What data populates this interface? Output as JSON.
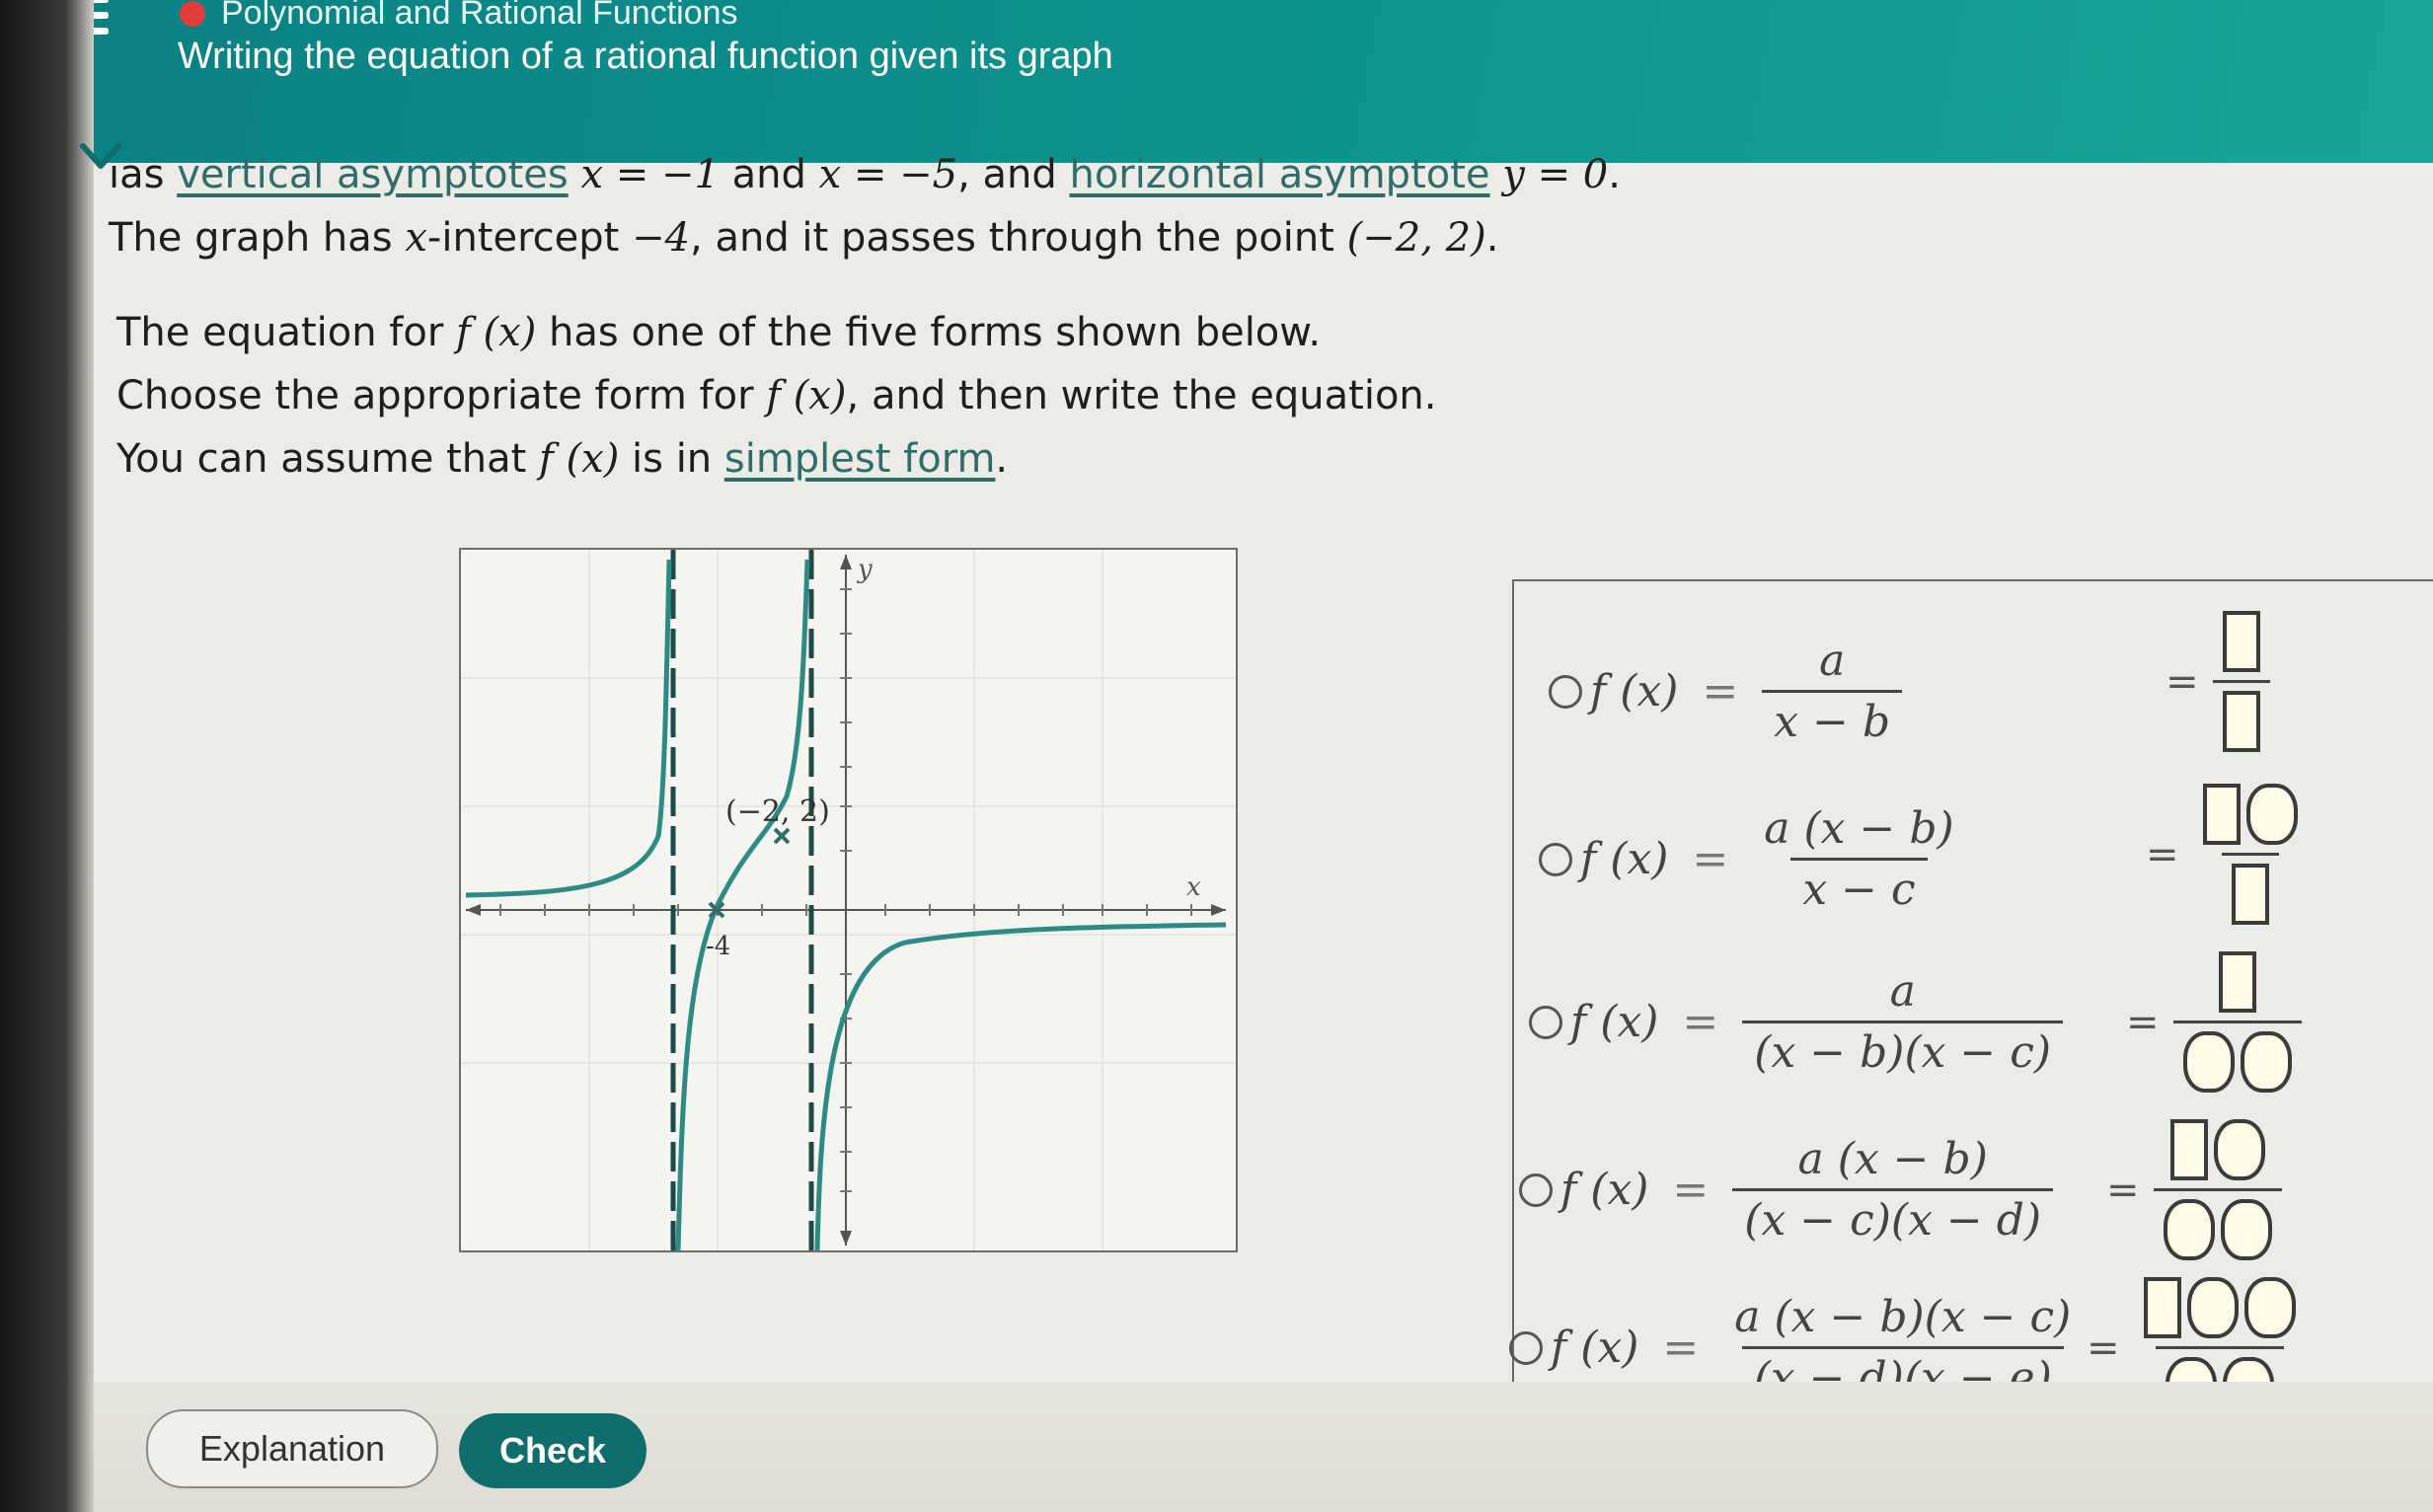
{
  "header": {
    "topic": "Polynomial and Rational Functions",
    "title": "Writing the equation of a rational function given its graph"
  },
  "problem": {
    "l1_a": "ıas ",
    "l1_link1": "vertical asymptotes",
    "l1_m1": "x = −1",
    "l1_and": " and ",
    "l1_m2": "x = −5",
    "l1_b": ", and ",
    "l1_link2": "horizontal asymptote",
    "l1_m3": "y = 0",
    "l1_end": ".",
    "l2_a": "The graph has ",
    "l2_m1": "x",
    "l2_b": "-intercept ",
    "l2_m2": "−4",
    "l2_c": ", and it passes through the point ",
    "l2_m3": "(−2, 2)",
    "l2_end": "."
  },
  "instructions": {
    "l1_a": "The equation for ",
    "fx": "f (x)",
    "l1_b": " has one of the five forms shown below.",
    "l2_a": "Choose the appropriate form for ",
    "l2_b": ", and then write the equation.",
    "l3_a": "You can assume that ",
    "l3_b": " is in ",
    "l3_link": "simplest form",
    "l3_end": "."
  },
  "graph": {
    "y_label": "y",
    "x_label": "x",
    "point_label": "(−2, 2)",
    "intercept_label": "-4",
    "curve_color": "#2e8b83",
    "asymptote_color": "#1f4a47"
  },
  "forms": {
    "lhs": "f (x)",
    "eq": "=",
    "f1_num": "a",
    "f1_den": "x − b",
    "f2_num": "a (x − b)",
    "f2_den": "x − c",
    "f3_num": "a",
    "f3_den": "(x − b)(x − c)",
    "f4_num": "a (x − b)",
    "f4_den": "(x − c)(x − d)",
    "f5_num": "a (x − b)(x − c)",
    "f5_den": "(x − d)(x − e)"
  },
  "buttons": {
    "explanation": "Explanation",
    "check": "Check"
  }
}
